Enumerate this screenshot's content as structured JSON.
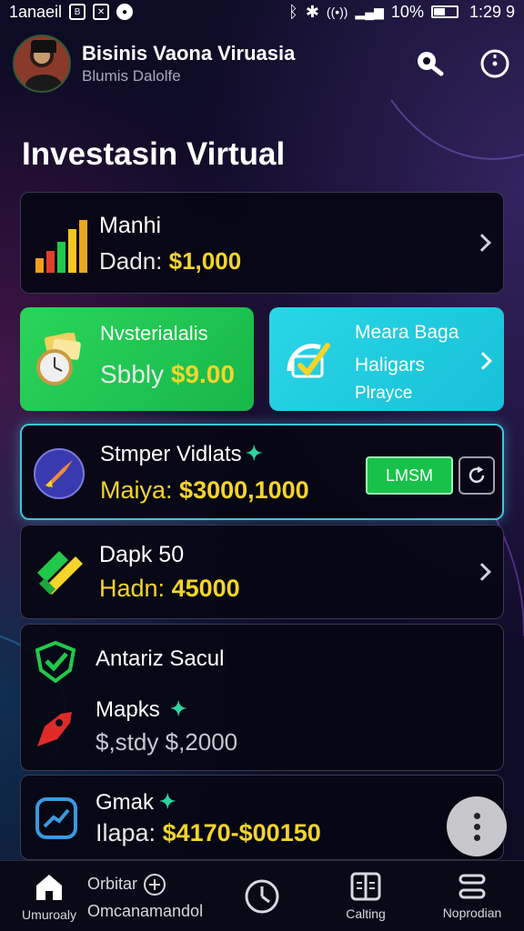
{
  "status_bar": {
    "carrier": "1anaeil",
    "battery": "10%",
    "time": "1:29 9"
  },
  "header": {
    "title": "Bisinis Vaona Viruasia",
    "subtitle": "Blumis Dalolfe"
  },
  "page_title": "Investasin Virtual",
  "cards": {
    "manhi": {
      "name": "Manhi",
      "label": "Dadn:",
      "value": "$1,000"
    },
    "nvsteri": {
      "name": "Nvsterialalis",
      "label": "Sbbly",
      "value": "$9.00"
    },
    "meara": {
      "line1": "Meara Baga",
      "line2": "Haligars",
      "line3": "Plrayce"
    },
    "stomper": {
      "name": "Stmper Vidlats",
      "label": "Maiya:",
      "value": "$3000,1000",
      "action_label": "LMSM"
    },
    "dapk": {
      "name": "Dapk 50",
      "label": "Hadn:",
      "value": "45000"
    },
    "antariz": {
      "title": "Antariz Sacul",
      "name": "Mapks",
      "label": "$,stdy",
      "value": "$,2000"
    },
    "gmak": {
      "name": "Gmak",
      "label": "Ilapa:",
      "value": "$4170-$00150"
    }
  },
  "bottom_nav": {
    "home": "Umuroaly",
    "middle_top": "Orbitar",
    "middle": "Omcanamandol",
    "calling": "Calting",
    "noprodian": "Noprodian"
  },
  "colors": {
    "accent_yellow": "#f5d52a",
    "green_card": "#22c950",
    "cyan_card": "#22cce0",
    "glow": "#3fc4d8"
  }
}
